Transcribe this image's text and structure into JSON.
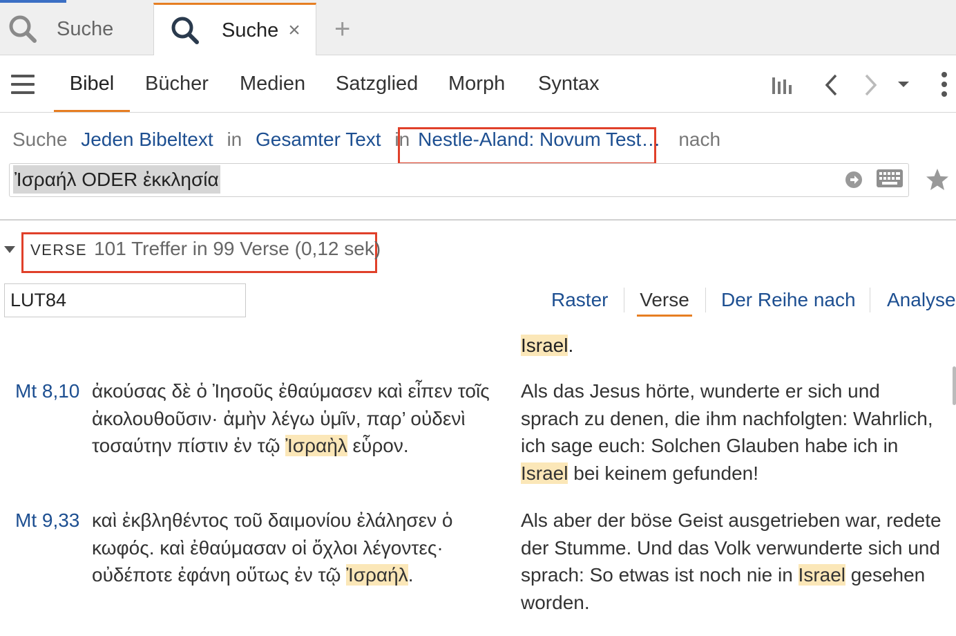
{
  "tabs": [
    {
      "label": "Suche",
      "icon": "search-icon",
      "active": false
    },
    {
      "label": "Suche",
      "icon": "search-icon",
      "active": true,
      "close": "×"
    }
  ],
  "new_tab": "+",
  "nav": {
    "menu_icon": "hamburger-menu-icon",
    "tabs": [
      "Bibel",
      "Bücher",
      "Medien",
      "Satzglied",
      "Morph",
      "Syntax"
    ],
    "active_tab": "Bibel",
    "icons": [
      "chart-bars-icon",
      "chevron-left-icon",
      "chevron-right-icon",
      "caret-down-icon",
      "more-vertical-icon"
    ]
  },
  "query": {
    "w1": "Suche",
    "scope": "Jeden Bibeltext",
    "w2": "in",
    "range": "Gesamter Text",
    "w3": "in",
    "resource": "Nestle-Aland: Novum Test…",
    "w4": "nach",
    "search_text": "Ἰσραήλ ODER ἐκκλησία"
  },
  "results": {
    "label": "VERSE",
    "summary": "101 Treffer in 99 Verse (0,12 sek)",
    "translation": "LUT84",
    "views": [
      "Raster",
      "Verse",
      "Der Reihe nach",
      "Analyse"
    ],
    "active_view": "Verse",
    "prev_fragment": {
      "hl": "Israel",
      "rest": "."
    },
    "verses": [
      {
        "ref": "Mt 8,10",
        "greek": {
          "pre": "ἀκούσας δὲ ὁ Ἰησοῦς ἐθαύμασεν καὶ εἶπεν τοῖς ἀκολουθοῦσιν· ἀμὴν λέγω ὑμῖν, παρ’ οὐδενὶ τοσαύτην πίστιν ἐν τῷ ",
          "hl": "Ἰσραὴλ",
          "post": " εὗρον."
        },
        "german": {
          "pre": "Als das Jesus hörte, wunderte er sich und sprach zu denen, die ihm nachfolgten: Wahrlich, ich sage euch: Solchen Glauben habe ich in ",
          "hl": "Israel",
          "post": " bei keinem gefunden!"
        }
      },
      {
        "ref": "Mt 9,33",
        "greek": {
          "pre": "καὶ ἐκβληθέντος τοῦ δαιμονίου ἐλάλησεν ὁ κωφός. καὶ ἐθαύμασαν οἱ ὄχλοι λέγοντες· οὐδέποτε ἐφάνη οὕτως ἐν τῷ ",
          "hl": "Ἰσραήλ",
          "post": "."
        },
        "german": {
          "pre": "Als aber der böse Geist ausgetrieben war, redete der Stumme. Und das Volk verwunderte sich und sprach: So etwas ist noch nie in ",
          "hl": "Israel",
          "post": " gesehen worden."
        }
      }
    ]
  },
  "colors": {
    "accent": "#e67e22",
    "link": "#1d4f91",
    "highlight": "#fbe7b8",
    "annotation_box": "#e0402a"
  }
}
